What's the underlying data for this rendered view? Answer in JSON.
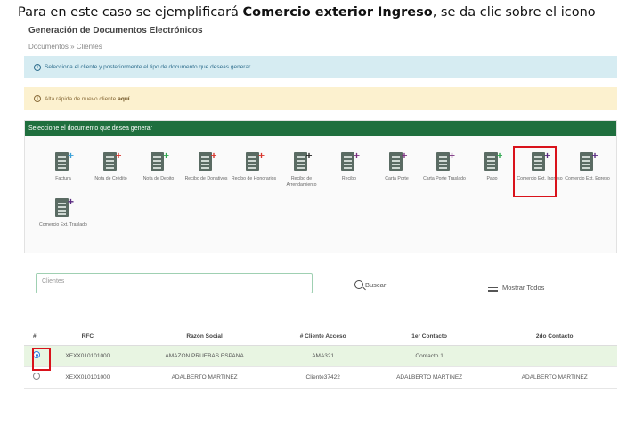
{
  "caption": {
    "pre": "Para en este caso se ejemplificará ",
    "bold": "Comercio exterior Ingreso",
    "post": ", se da clic sobre el icono"
  },
  "app": {
    "title": "Generación de Documentos Electrónicos",
    "breadcrumb": "Documentos » Clientes"
  },
  "info_alert": {
    "icon": "info-circle-icon",
    "text": "Selecciona el cliente y posteriormente el tipo de documento que deseas generar."
  },
  "warn_alert": {
    "icon": "info-circle-icon",
    "text": "Alta rápida de nuevo cliente",
    "link": "aquí."
  },
  "documents": {
    "header": "Seleccione el documento que desea generar",
    "items": [
      {
        "label": "Factura",
        "plus_color": "#3aa1d8"
      },
      {
        "label": "Nota de Crédito",
        "plus_color": "#d9342b"
      },
      {
        "label": "Nota de Debito",
        "plus_color": "#2fa84f"
      },
      {
        "label": "Recibo de Donativos",
        "plus_color": "#d9342b"
      },
      {
        "label": "Recibo de Honorarios",
        "plus_color": "#d9342b"
      },
      {
        "label": "Recibo de Arrendamiento",
        "plus_color": "#222222"
      },
      {
        "label": "Recibo",
        "plus_color": "#7a2f7f"
      },
      {
        "label": "Carta Porte",
        "plus_color": "#7a2f7f"
      },
      {
        "label": "Carta Porte Traslado",
        "plus_color": "#7a2f7f"
      },
      {
        "label": "Pago",
        "plus_color": "#2fa84f"
      },
      {
        "label": "Comercio Ext. Ingreso",
        "plus_color": "#5a2a82"
      },
      {
        "label": "Comercio Ext. Egreso",
        "plus_color": "#5a2a82"
      },
      {
        "label": "Comercio Ext. Traslado",
        "plus_color": "#5a2a82"
      }
    ]
  },
  "search": {
    "placeholder": "Clientes",
    "buscar_label": "Buscar",
    "mostrar_label": "Mostrar Todos"
  },
  "table": {
    "headers": [
      "#",
      "RFC",
      "Razón Social",
      "# Cliente Acceso",
      "1er Contacto",
      "2do Contacto"
    ],
    "rows": [
      {
        "selected": true,
        "rfc": "XEXX010101000",
        "razon": "AMAZON PRUEBAS ESPANA",
        "cliente": "AMA321",
        "c1": "Contacto 1",
        "c2": ""
      },
      {
        "selected": false,
        "rfc": "XEXX010101000",
        "razon": "ADALBERTO MARTINEZ",
        "cliente": "Cliente37422",
        "c1": "ADALBERTO MARTINEZ",
        "c2": "ADALBERTO MARTINEZ"
      }
    ]
  },
  "colors": {
    "header_green": "#1f6f3e",
    "highlight_red": "#d9121b",
    "selected_row": "#e8f5e2"
  }
}
